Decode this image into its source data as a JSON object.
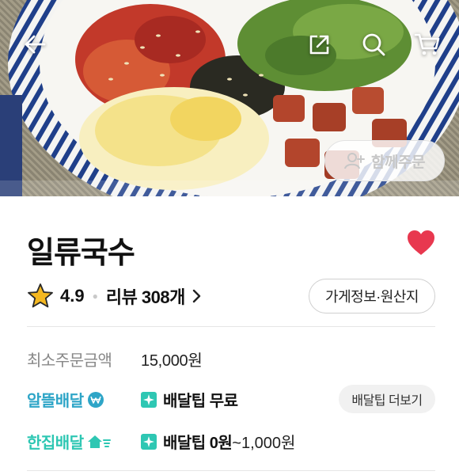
{
  "store": {
    "name": "일류국수",
    "rating": "4.9",
    "review_label": "리뷰 308개",
    "info_button": "가게정보·원산지",
    "favorited": true
  },
  "actions": {
    "together_order": "함께주문"
  },
  "min_order": {
    "label": "최소주문금액",
    "value": "15,000원"
  },
  "delivery": {
    "altteul": {
      "label": "알뜰배달",
      "tip_text": "배달팁 무료"
    },
    "hanjip": {
      "label": "한집배달",
      "tip_bold": "배달팁 0원",
      "tip_rest": "~1,000원"
    },
    "more_tips_button": "배달팁 더보기"
  },
  "icons": {
    "back": "back-arrow-icon",
    "share": "share-icon",
    "search": "search-icon",
    "cart": "cart-icon",
    "heart": "heart-icon",
    "star": "star-icon",
    "badge": "sparkle-badge-icon"
  },
  "colors": {
    "heart": "#e8384f",
    "star": "#f5b820",
    "altteul": "#2ea5c7",
    "hanjip": "#2ec7b3",
    "badge": "#2ec7b3"
  }
}
